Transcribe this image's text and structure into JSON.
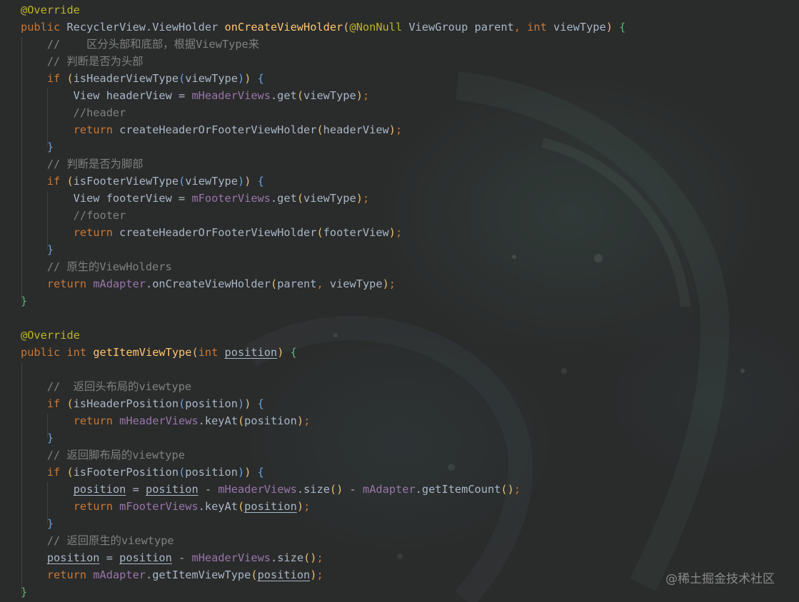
{
  "editor": {
    "language": "java",
    "theme": "darcula",
    "colors": {
      "background": "#2b2b2b",
      "default_text": "#a9b7c6",
      "keyword": "#cc7832",
      "annotation": "#bbb529",
      "method_declaration": "#ffc66d",
      "comment": "#808080",
      "field": "#9876aa"
    },
    "code_lines": [
      "@Override",
      "public RecyclerView.ViewHolder onCreateViewHolder(@NonNull ViewGroup parent, int viewType) {",
      "    //    区分头部和底部，根据ViewType来",
      "    // 判断是否为头部",
      "    if (isHeaderViewType(viewType)) {",
      "        View headerView = mHeaderViews.get(viewType);",
      "        //header",
      "        return createHeaderOrFooterViewHolder(headerView);",
      "    }",
      "    // 判断是否为脚部",
      "    if (isFooterViewType(viewType)) {",
      "        View footerView = mFooterViews.get(viewType);",
      "        //footer",
      "        return createHeaderOrFooterViewHolder(footerView);",
      "    }",
      "    // 原生的ViewHolders",
      "    return mAdapter.onCreateViewHolder(parent, viewType);",
      "}",
      "",
      "@Override",
      "public int getItemViewType(int position) {",
      "",
      "    //  返回头布局的viewtype",
      "    if (isHeaderPosition(position)) {",
      "        return mHeaderViews.keyAt(position);",
      "    }",
      "    // 返回脚布局的viewtype",
      "    if (isFooterPosition(position)) {",
      "        position = position - mHeaderViews.size() - mAdapter.getItemCount();",
      "        return mFooterViews.keyAt(position);",
      "    }",
      "    // 返回原生的viewtype",
      "    position = position - mHeaderViews.size();",
      "    return mAdapter.getItemViewType(position);",
      "}"
    ]
  },
  "watermark": {
    "text": "@稀土掘金技术社区"
  }
}
